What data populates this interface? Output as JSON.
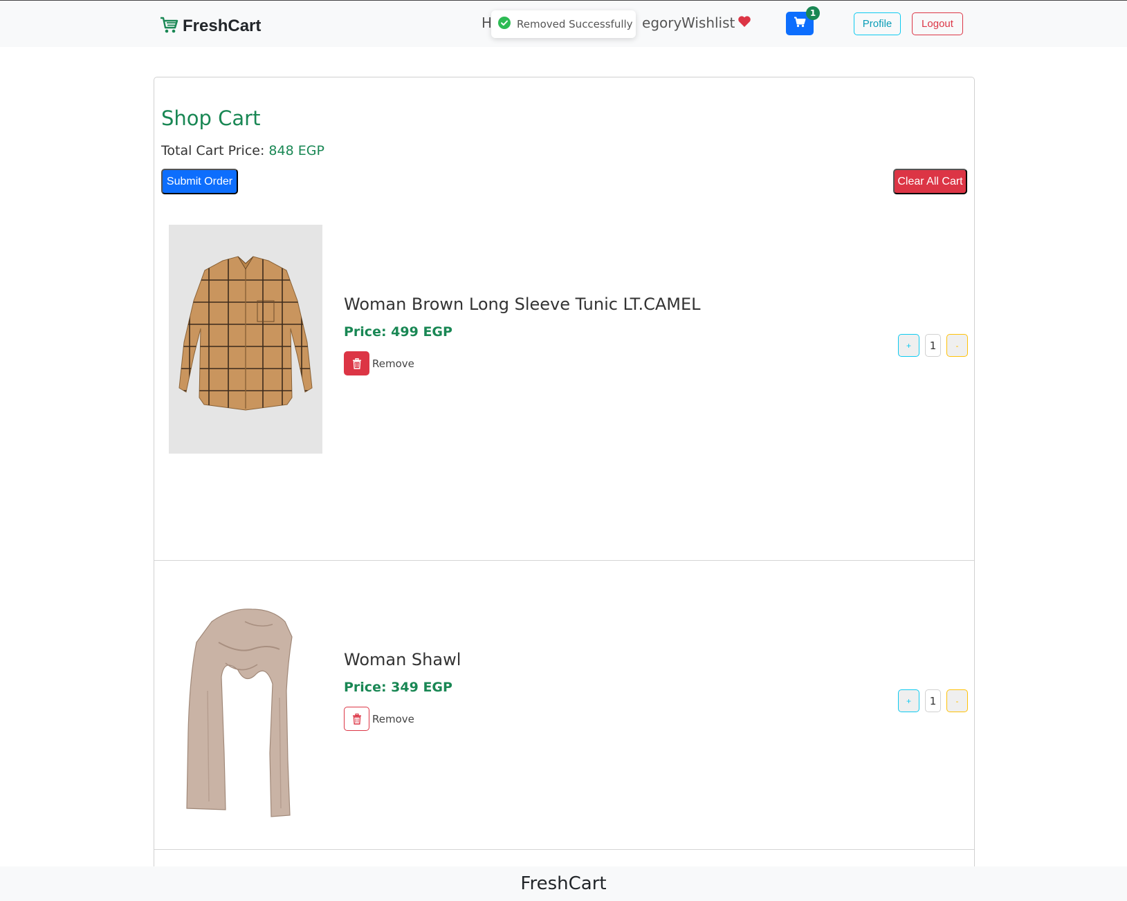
{
  "brand": {
    "name": "FreshCart",
    "icon": "cart-icon",
    "color": "#198754"
  },
  "nav": {
    "home_label": "H",
    "category_label": "egory",
    "wishlist_label": "Wishlist",
    "wishlist_icon": "heart-icon",
    "cart_badge": "1",
    "profile_label": "Profile",
    "logout_label": "Logout"
  },
  "toast": {
    "message": "Removed Successfully",
    "icon": "check-circle-icon"
  },
  "cart": {
    "title": "Shop Cart",
    "total_label": "Total Cart Price: ",
    "total_value": "848 EGP",
    "submit_label": "Submit Order",
    "clear_label": "Clear All Cart",
    "items": [
      {
        "title": "Woman Brown Long Sleeve Tunic LT.CAMEL",
        "price": "Price: 499 EGP",
        "remove_label": "Remove",
        "quantity": "1",
        "plus": "+",
        "minus": "-"
      },
      {
        "title": "Woman Shawl",
        "price": "Price: 349 EGP",
        "remove_label": "Remove",
        "quantity": "1",
        "plus": "+",
        "minus": "-"
      }
    ]
  },
  "footer": {
    "text": "FreshCart"
  },
  "colors": {
    "primary": "#0d6efd",
    "danger": "#dc3545",
    "success": "#198754",
    "info": "#0dcaf0",
    "warning": "#ffc107"
  }
}
